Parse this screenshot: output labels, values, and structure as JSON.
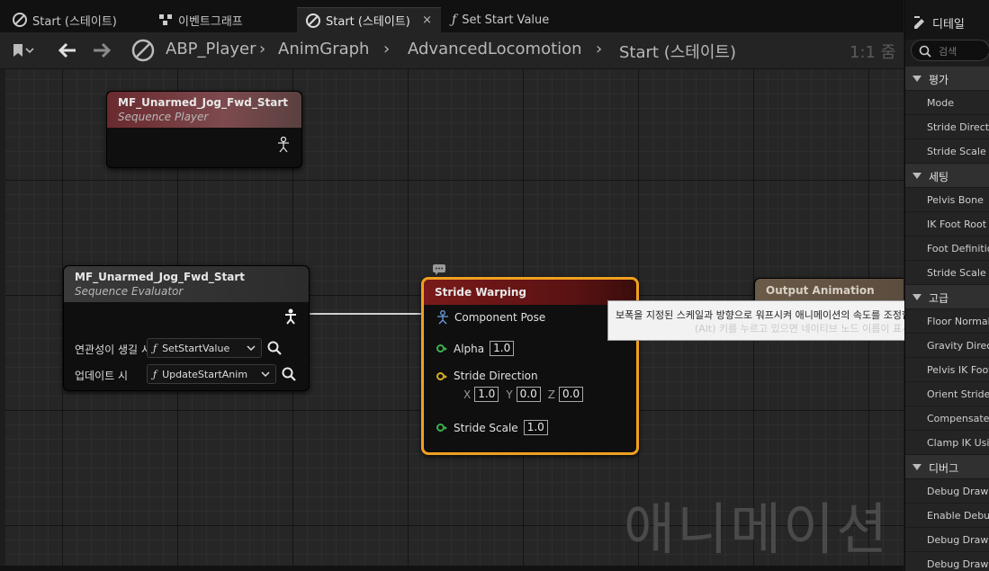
{
  "tabs": [
    {
      "label": "Start (스테이트)",
      "icon": "state-icon"
    },
    {
      "label": "이벤트그래프",
      "icon": "graph-icon"
    },
    {
      "label": "Start (스테이트)",
      "icon": "state-icon",
      "active": true,
      "close": "×"
    },
    {
      "label": "Set Start Value",
      "icon": "function-icon"
    }
  ],
  "breadcrumb": {
    "items": [
      "ABP_Player",
      "AnimGraph",
      "AdvancedLocomotion",
      "Start (스테이트)"
    ],
    "zoom": "1:1 줌"
  },
  "nodes": {
    "sequence_player": {
      "title": "MF_Unarmed_Jog_Fwd_Start",
      "subtitle": "Sequence Player"
    },
    "sequence_evaluator": {
      "title": "MF_Unarmed_Jog_Fwd_Start",
      "subtitle": "Sequence Evaluator",
      "rows": [
        {
          "label": "연관성이 생길 시",
          "function": "SetStartValue"
        },
        {
          "label": "업데이트 시",
          "function": "UpdateStartAnim"
        }
      ]
    },
    "stride_warping": {
      "title": "Stride Warping",
      "component_pose": "Component Pose",
      "alpha_label": "Alpha",
      "alpha_value": "1.0",
      "direction_label": "Stride Direction",
      "x_label": "X",
      "x_value": "1.0",
      "y_label": "Y",
      "y_value": "0.0",
      "z_label": "Z",
      "z_value": "0.0",
      "scale_label": "Stride Scale",
      "scale_value": "1.0",
      "comment_icon": "comment-bubble-icon"
    },
    "output_pose": {
      "title": "Output Animation Pose"
    }
  },
  "tooltip": {
    "text": "보폭을 지정된 스케일과 방향으로 워프시켜 애니메이션의 속도를 조정합니다.",
    "hint": "(Alt) 키를 누르고 있으면 네이티브 노드 이름이 표시됩니다"
  },
  "details_panel": {
    "title": "디테일",
    "search_placeholder": "검색",
    "categories": [
      {
        "label": "평가",
        "items": [
          "Mode",
          "Stride Direction",
          "Stride Scale"
        ]
      },
      {
        "label": "세팅",
        "items": [
          "Pelvis Bone",
          "IK Foot Root Bone",
          "Foot Definitions",
          "Stride Scale Modifier"
        ]
      },
      {
        "label": "고급",
        "items": [
          "Floor Normal",
          "Gravity Direction",
          "Pelvis IK Foot",
          "Orient Stride Direction",
          "Compensate IK",
          "Clamp IK Using"
        ]
      },
      {
        "label": "디버그",
        "items": [
          "Debug Draw Stride",
          "Enable Debug",
          "Debug Draw IK",
          "Debug Draw IK"
        ]
      }
    ]
  },
  "watermark": "애니메이션",
  "colors": {
    "selection_orange": "#f0a020",
    "pose_wire": "#cfcfcf",
    "alpha_pin_green": "#3bb34a",
    "direction_pin_yellow": "#d8b020"
  }
}
